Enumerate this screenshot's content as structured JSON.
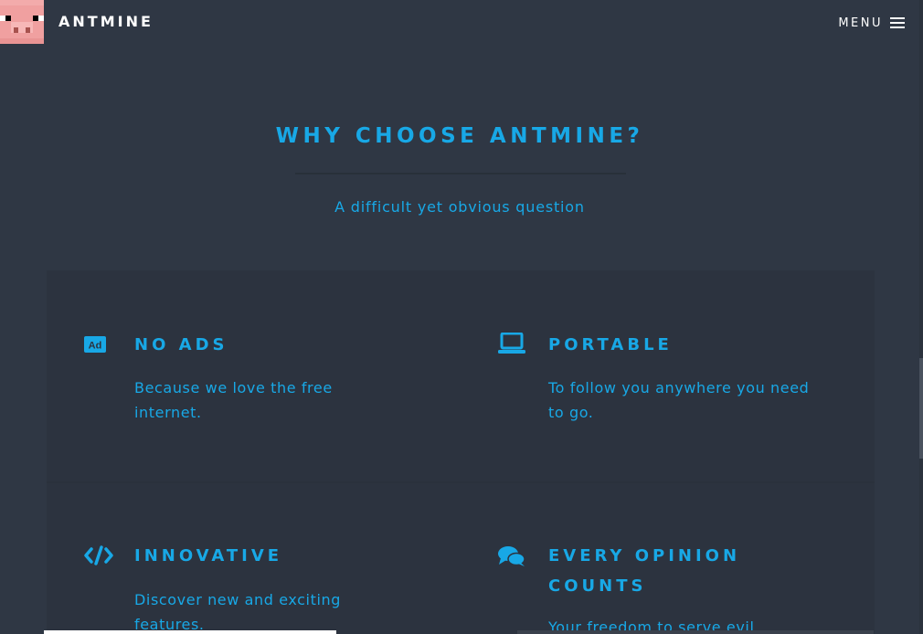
{
  "header": {
    "brand": "ANTMINE",
    "menu_label": "MENU",
    "logo_icon": "pig-face-icon",
    "menu_icon": "hamburger-icon"
  },
  "section": {
    "title": "WHY CHOOSE ANTMINE?",
    "subtitle": "A difficult yet obvious question"
  },
  "features": [
    {
      "icon": "ad-icon",
      "title": "NO ADS",
      "text": "Because we love the free internet."
    },
    {
      "icon": "laptop-icon",
      "title": "PORTABLE",
      "text": "To follow you anywhere you need to go."
    },
    {
      "icon": "code-icon",
      "title": "INNOVATIVE",
      "text": "Discover new and exciting features."
    },
    {
      "icon": "comments-icon",
      "title": "EVERY OPINION COUNTS",
      "text": "Your freedom to serve evil"
    }
  ],
  "colors": {
    "background": "#2f3744",
    "panel": "#2c333f",
    "accent": "#18a8e6",
    "text_light": "#ffffff",
    "pig_pink": "#f0a0a0"
  }
}
